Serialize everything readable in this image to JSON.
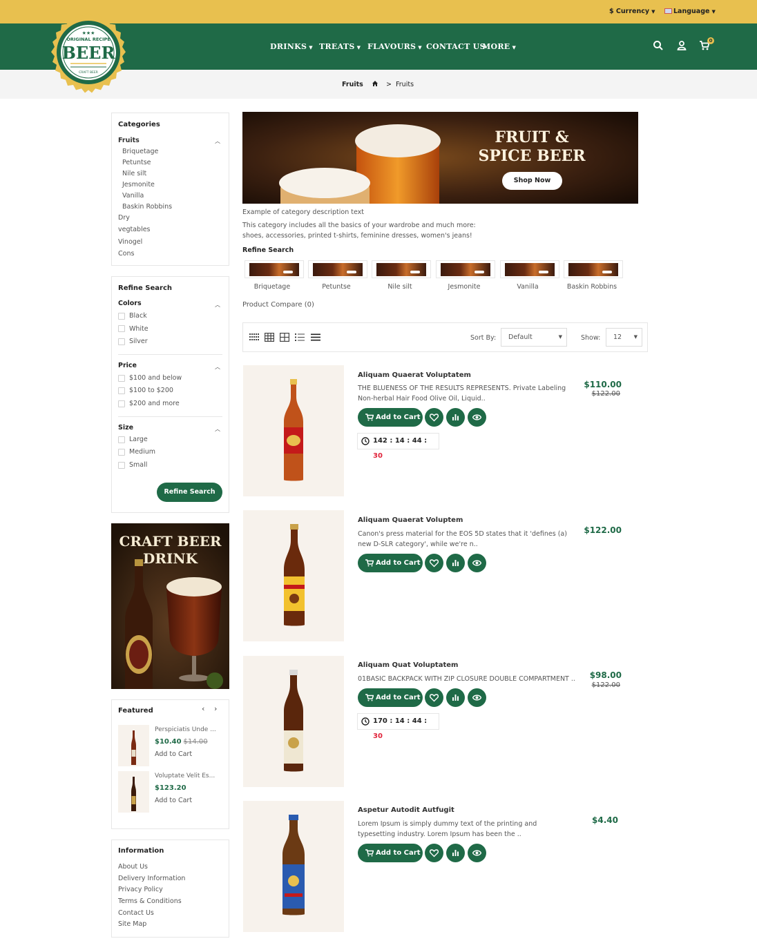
{
  "header": {
    "currency": "$ Currency",
    "language": "Language",
    "logo": {
      "top": "ORIGINAL RECIPE",
      "main": "BEER",
      "bottom": "CRAFT BEER"
    },
    "nav": [
      "DRINKS",
      "TREATS",
      "FLAVOURS",
      "CONTACT US",
      "MORE"
    ],
    "cart_count": "0"
  },
  "breadcrumb": {
    "title": "Fruits",
    "current": "Fruits"
  },
  "sidebar": {
    "categories_title": "Categories",
    "categories": [
      {
        "label": "Fruits",
        "children": [
          "Briquetage",
          "Petuntse",
          "Nile silt",
          "Jesmonite",
          "Vanilla",
          "Baskin Robbins"
        ]
      },
      {
        "label": "Dry"
      },
      {
        "label": "vegtables"
      },
      {
        "label": "Vinogel"
      },
      {
        "label": "Cons"
      }
    ],
    "refine_title": "Refine Search",
    "colors_title": "Colors",
    "colors": [
      "Black",
      "White",
      "Silver"
    ],
    "price_title": "Price",
    "prices": [
      "$100 and below",
      "$100 to $200",
      "$200 and more"
    ],
    "size_title": "Size",
    "sizes": [
      "Large",
      "Medium",
      "Small"
    ],
    "refine_button": "Refine Search",
    "promo_title": "CRAFT BEER DRINK",
    "featured_title": "Featured",
    "featured": [
      {
        "name": "Perspiciatis Unde ...",
        "price": "$10.40",
        "old": "$14.00",
        "cart": "Add to Cart"
      },
      {
        "name": "Voluptate Velit Es...",
        "price": "$123.20",
        "old": "",
        "cart": "Add to Cart"
      }
    ],
    "info_title": "Information",
    "info_links": [
      "About Us",
      "Delivery Information",
      "Privacy Policy",
      "Terms & Conditions",
      "Contact Us",
      "Site Map"
    ]
  },
  "banner": {
    "title_line1": "FRUIT &",
    "title_line2": "SPICE BEER",
    "button": "Shop Now"
  },
  "category": {
    "desc1": "Example of category description text",
    "desc2": "This category includes all the basics of your wardrobe and much more:",
    "desc3": "shoes, accessories, printed t-shirts, feminine dresses, women's jeans!",
    "refine_title": "Refine Search",
    "subcategories": [
      "Briquetage",
      "Petuntse",
      "Nile silt",
      "Jesmonite",
      "Vanilla",
      "Baskin Robbins"
    ],
    "compare": "Product Compare (0)"
  },
  "toolbar": {
    "sort_label": "Sort By:",
    "sort_value": "Default",
    "show_label": "Show:",
    "show_value": "12"
  },
  "products": [
    {
      "name": "Aliquam Quaerat Voluptatem",
      "desc": "THE BLUENESS OF THE RESULTS REPRESENTS. Private Labeling Non-herbal Hair Food Olive Oil, Liquid..",
      "price": "$110.00",
      "old": "$122.00",
      "cart": "Add to Cart",
      "timer": {
        "days": "142",
        "hours": "14",
        "mins": "44",
        "secs": "30"
      }
    },
    {
      "name": "Aliquam Quaerat Voluptem",
      "desc": "Canon's press material for the EOS 5D states that it 'defines (a) new D-SLR category', while we're n..",
      "price": "$122.00",
      "old": "",
      "cart": "Add to Cart"
    },
    {
      "name": "Aliquam Quat Voluptatem",
      "desc": "01BASIC BACKPACK WITH ZIP CLOSURE DOUBLE COMPARTMENT ..",
      "price": "$98.00",
      "old": "$122.00",
      "cart": "Add to Cart",
      "timer": {
        "days": "170",
        "hours": "14",
        "mins": "44",
        "secs": "30"
      }
    },
    {
      "name": "Aspetur Autodit Autfugit",
      "desc": "Lorem Ipsum is simply dummy text of the printing and typesetting industry. Lorem Ipsum has been the ..",
      "price": "$4.40",
      "old": "",
      "cart": "Add to Cart"
    }
  ],
  "colors": {
    "green": "#1f6a47",
    "yellow": "#e8c04f",
    "red": "#e0243b"
  }
}
